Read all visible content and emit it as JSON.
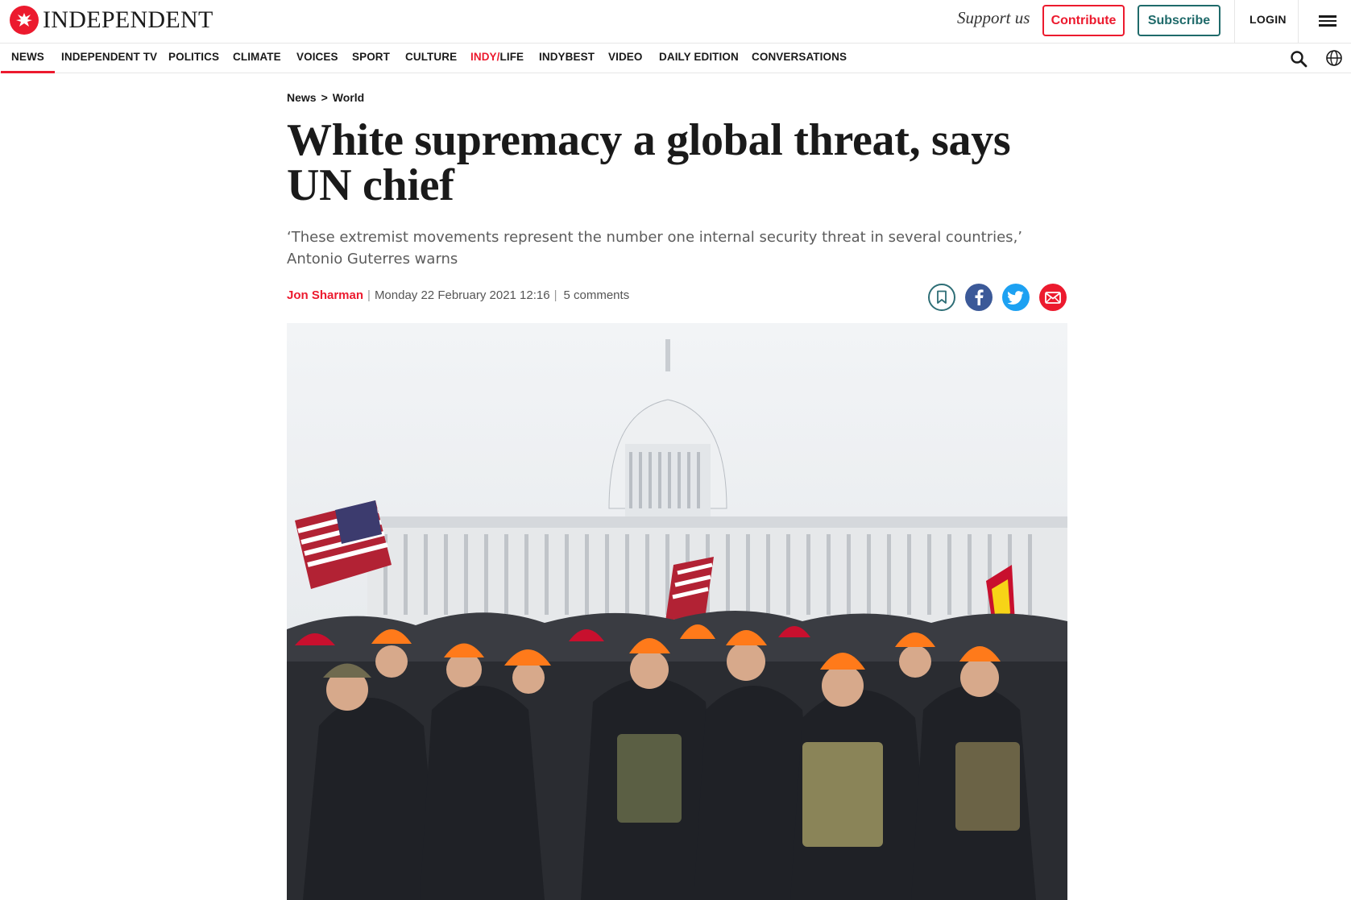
{
  "header": {
    "logo_text": "INDEPENDENT",
    "support_text": "Support us",
    "contribute_label": "Contribute",
    "subscribe_label": "Subscribe",
    "login_label": "LOGIN"
  },
  "nav": {
    "items": [
      {
        "label": "NEWS",
        "active": true
      },
      {
        "label": "INDEPENDENT TV"
      },
      {
        "label": "POLITICS"
      },
      {
        "label": "CLIMATE"
      },
      {
        "label": "VOICES"
      },
      {
        "label": "SPORT"
      },
      {
        "label": "CULTURE"
      },
      {
        "label_prefix": "INDY/",
        "label": "LIFE"
      },
      {
        "label": "INDYBEST"
      },
      {
        "label": "VIDEO"
      },
      {
        "label": "DAILY EDITION"
      },
      {
        "label": "CONVERSATIONS"
      }
    ]
  },
  "article": {
    "breadcrumb": {
      "section": "News",
      "separator": ">",
      "subsection": "World"
    },
    "headline": "White supremacy a global threat, says UN chief",
    "standfirst": "‘These extremist movements represent the number one internal security threat in several countries,’ Antonio Guterres warns",
    "author": "Jon Sharman",
    "date": "Monday 22 February 2021 12:16",
    "comments": "5 comments"
  },
  "colors": {
    "brand_red": "#ec1a2e",
    "subscribe_teal": "#1f6a6a",
    "facebook": "#3b5998",
    "twitter": "#1da1f2"
  },
  "icons": [
    "eagle-logo-icon",
    "menu-icon",
    "search-icon",
    "globe-icon",
    "bookmark-icon",
    "facebook-icon",
    "twitter-icon",
    "email-icon"
  ]
}
